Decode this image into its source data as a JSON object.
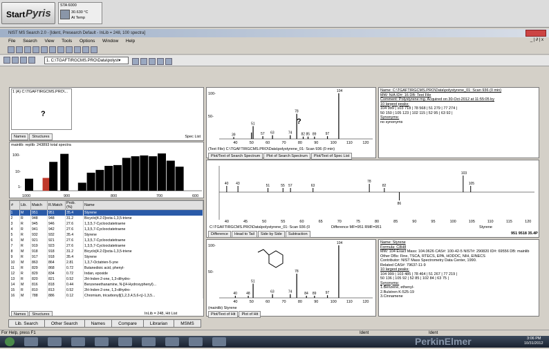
{
  "pyris": {
    "start": "Start",
    "app": "Pyris",
    "sta": "STA 6000",
    "temp": "30.630 °C",
    "status": "At Temp"
  },
  "window": {
    "title": "NIST MS Search 2.0 - [Ident, Presearch Default - InLib = 248, 100 spectra]",
    "minmax": "_ | ∂ | x"
  },
  "menu": [
    "File",
    "Search",
    "View",
    "Tools",
    "Options",
    "Window",
    "Help"
  ],
  "toolbar": {
    "path": "1. C:\\TGAFTIRGCMS.PRO\\Data\\polyst▾"
  },
  "structure_panel": {
    "header": "1 (A) C:\\TGAFTIRGCMS.PRO\\...",
    "question": "?",
    "tabs": [
      "Names",
      "Structures"
    ],
    "spec_list": "Spec List"
  },
  "histogram": {
    "label": "mainlib: replib: 243893 total spectra",
    "y_ticks": [
      "100-",
      "10-",
      "1-"
    ],
    "x_ticks": [
      "1000",
      "900",
      "800",
      "700",
      "600"
    ],
    "bars": [
      {
        "x": 1000,
        "h": 0.3,
        "c": "#000"
      },
      {
        "x": 960,
        "h": 0.32,
        "c": "#c0392b"
      },
      {
        "x": 945,
        "h": 0.72,
        "c": "#000"
      },
      {
        "x": 920,
        "h": 0.92,
        "c": "#000"
      },
      {
        "x": 880,
        "h": 0.2,
        "c": "#000"
      },
      {
        "x": 860,
        "h": 0.45,
        "c": "#000"
      },
      {
        "x": 840,
        "h": 0.52,
        "c": "#000"
      },
      {
        "x": 820,
        "h": 0.62,
        "c": "#000"
      },
      {
        "x": 800,
        "h": 0.64,
        "c": "#000"
      },
      {
        "x": 780,
        "h": 0.82,
        "c": "#000"
      },
      {
        "x": 760,
        "h": 0.86,
        "c": "#000"
      },
      {
        "x": 740,
        "h": 0.88,
        "c": "#000"
      },
      {
        "x": 720,
        "h": 0.86,
        "c": "#000"
      },
      {
        "x": 700,
        "h": 0.93,
        "c": "#000"
      },
      {
        "x": 680,
        "h": 0.75,
        "c": "#000"
      },
      {
        "x": 660,
        "h": 0.6,
        "c": "#000"
      }
    ]
  },
  "hitlist": {
    "headers": [
      "#",
      "Lib.",
      "Match",
      "R.Match",
      "Prob. (%)",
      "Name"
    ],
    "rows": [
      [
        "1",
        "M",
        "951",
        "951",
        "35.4",
        "Styrene"
      ],
      [
        "2",
        "R",
        "948",
        "948",
        "31.2",
        "Bicyclo[4.2.0]octa-1,3,5-triene"
      ],
      [
        "3",
        "R",
        "945",
        "946",
        "27.6",
        "1,3,5,7-Cyclooctatetraene"
      ],
      [
        "4",
        "R",
        "941",
        "942",
        "27.6",
        "1,3,5,7-Cyclooctatetraene"
      ],
      [
        "5",
        "R",
        "932",
        "932",
        "35.4",
        "Styrene"
      ],
      [
        "6",
        "M",
        "921",
        "921",
        "27.6",
        "1,3,5,7-Cyclooctatetraene"
      ],
      [
        "7",
        "R",
        "919",
        "923",
        "27.6",
        "1,3,5,7-Cyclooctatetraene"
      ],
      [
        "8",
        "M",
        "918",
        "918",
        "31.2",
        "Bicyclo[4.2.0]octa-1,3,5-triene"
      ],
      [
        "9",
        "R",
        "917",
        "918",
        "35.4",
        "Styrene"
      ],
      [
        "10",
        "M",
        "863",
        "864",
        "2.81",
        "1,3,7-Octatrien-5-yne"
      ],
      [
        "11",
        "R",
        "829",
        "868",
        "0.72",
        "Butanedioic acid, phenyl-"
      ],
      [
        "12",
        "R",
        "829",
        "834",
        "0.72",
        "Indan, epoxide"
      ],
      [
        "13",
        "R",
        "820",
        "821",
        "0.52",
        "2H-Inden-2-one, 1,3-dihydro-"
      ],
      [
        "14",
        "M",
        "816",
        "818",
        "0.44",
        "Benzeneethanamine, N-[(4-Hydroxyphenyl)..."
      ],
      [
        "15",
        "R",
        "810",
        "813",
        "0.52",
        "2H-Inden-2-one, 1,3-dihydro-"
      ],
      [
        "16",
        "M",
        "788",
        "886",
        "0.12",
        "Chromium, tricarbonyl[(1,2,3,4,5,6-η)-1,3,5..."
      ]
    ],
    "tabs": [
      "Names",
      "Structures"
    ],
    "summary": "InLib = 248, Hit List"
  },
  "spec_info": {
    "name": "Name: C:\\TGAFTIRGCMS.PRO\\Data\\polystyrene_01: Scan 936 (0 min)",
    "mw": "MW: N/A ID#: 16 DB: Test File",
    "comment": "Comment: Polystyrene mg. Acquired on 30-Oct-2012 at 11:55:05 by",
    "peaks_hdr": "10 largest peaks:",
    "peaks1": "104 999 | 103 718 | 78 568 | 51 279 | 77 274 |",
    "peaks2": "50 150 | 105 123 | 102 115 | 52 95 | 63 92 |",
    "syn_hdr": "Synonyms:",
    "syn": "no synonyms"
  },
  "hit_info": {
    "name": "Name: Styrene",
    "formula": "Formula: C8H8",
    "mw": "MW: 104 Exact Mass: 104.0626 CAS#: 100-42-5 NIST#: 290820 ID#: 69556 DB: mainlib",
    "other": "Other DBs: Fine, TSCA, RTECS, EPA, HODOC, NIH, EINECS",
    "contrib": "Contributor: NIST Mass Spectrometry Data Center, 1990.",
    "related": "Related CAS#: 79637-11-9",
    "peaks_hdr": "10 largest peaks:",
    "peaks1": "104 999 | 103 485 | 78 464 | 51 267 | 77 219 |",
    "peaks2": "50 136 | 105 92 | 52 85 | 102 84 | 63 75 |",
    "syn_hdr": "Synonyms:",
    "syn1": "1.Benzene, ethenyl-",
    "syn2": "2.Bulstren K-525-19",
    "syn3": "3.Cinnamene"
  },
  "search_plot": {
    "caption": "(Text File) C:\\TGAFTIRGCMS.PRO\\Data\\polystyrene_01: Scan 936 (0 min)",
    "tabs": [
      "Plot/Text of Search Spectrum",
      "Plot of Search Spectrum",
      "Plot/Text of Spec List"
    ],
    "question": "?"
  },
  "diff_plot": {
    "caption_left": "C:\\TGAFTIRGCMS.PRO\\Data\\polystyrene_01: Scan 936 (0",
    "caption_mid": "Difference MF=951 RMF=951",
    "caption_right": "Styrene",
    "scores": "951 9518 35.4P",
    "tabs": [
      "Difference",
      "Head to Tail",
      "Side by Side",
      "Subtraction"
    ],
    "x_ticks": [
      "40",
      "45",
      "50",
      "55",
      "60",
      "65",
      "70",
      "75",
      "80",
      "85",
      "90",
      "95",
      "100",
      "105",
      "110",
      "115",
      "120"
    ]
  },
  "lib_plot": {
    "caption": "(mainlib) Styrene",
    "tabs": [
      "Plot/Text of Hit",
      "Plot of Hit"
    ]
  },
  "chart_data": [
    {
      "type": "bar",
      "title": "",
      "xlabel": "",
      "ylabel": "",
      "xlim": [
        30,
        125
      ],
      "ylim": [
        0,
        100
      ],
      "x": [
        39,
        50,
        51,
        57,
        63,
        74,
        78,
        82,
        85,
        89,
        97,
        104
      ],
      "values": [
        4,
        14,
        28,
        6,
        8,
        8,
        55,
        5,
        5,
        5,
        6,
        100
      ],
      "labels": [
        "39",
        "",
        "51",
        "57",
        "63",
        "74",
        "78",
        "82",
        "85",
        "89",
        "97",
        "104"
      ],
      "y_ticks": [
        "100-",
        "50-"
      ],
      "x_ticks": [
        "40",
        "50",
        "60",
        "70",
        "80",
        "90",
        "100",
        "110",
        "120"
      ]
    },
    {
      "type": "bar",
      "title": "",
      "xlabel": "",
      "ylabel": "",
      "x": [
        40,
        43,
        51,
        55,
        57,
        63,
        78,
        82,
        86,
        103,
        105
      ],
      "values": [
        3,
        3,
        2,
        2,
        2,
        2,
        4,
        2,
        -4,
        8,
        3
      ],
      "labels": [
        "40",
        "43",
        "51",
        "55",
        "57",
        "63",
        "78",
        "82",
        "86",
        "103",
        "105"
      ]
    },
    {
      "type": "bar",
      "title": "",
      "xlabel": "",
      "ylabel": "",
      "xlim": [
        30,
        125
      ],
      "ylim": [
        0,
        100
      ],
      "x": [
        40,
        48,
        51,
        63,
        74,
        78,
        84,
        89,
        97,
        104
      ],
      "values": [
        4,
        4,
        27,
        7,
        7,
        46,
        4,
        4,
        5,
        100
      ],
      "labels": [
        "40",
        "48",
        "51",
        "63",
        "74",
        "78",
        "84",
        "89",
        "97",
        "104"
      ],
      "y_ticks": [
        "100-",
        "50-"
      ],
      "x_ticks": [
        "40",
        "50",
        "60",
        "70",
        "80",
        "90",
        "100",
        "110",
        "120"
      ]
    }
  ],
  "bottom_tabs": [
    "Lib. Search",
    "Other Search",
    "Names",
    "Compare",
    "Librarian",
    "MSMS"
  ],
  "status": {
    "left": "For Help, press F1",
    "mid": "Ident",
    "right": "Ident"
  },
  "taskbar": {
    "brand": "PerkinElmer",
    "time": "3:06 PM",
    "date": "10/31/2012"
  }
}
